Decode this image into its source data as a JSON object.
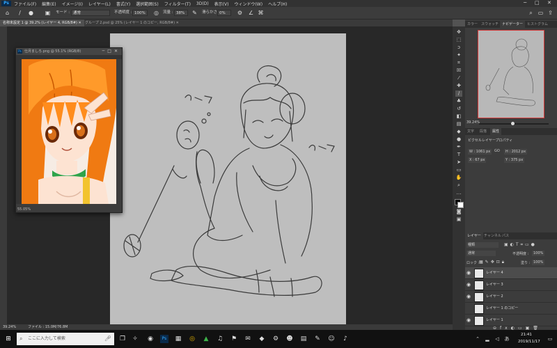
{
  "menubar": {
    "items": [
      "ファイル(F)",
      "編集(E)",
      "イメージ(I)",
      "レイヤー(L)",
      "書式(Y)",
      "選択範囲(S)",
      "フィルター(T)",
      "3D(D)",
      "表示(V)",
      "ウィンドウ(W)",
      "ヘルプ(H)"
    ],
    "window_controls": [
      "─",
      "□",
      "✕"
    ]
  },
  "options": {
    "mode_label": "モード :",
    "mode_value": "通常",
    "opacity_label": "不透明度 :",
    "opacity_value": "100%",
    "flow_label": "流量 :",
    "flow_value": "38%",
    "smoothing_label": "滑らかさ :",
    "smoothing_value": "0%"
  },
  "tabs": [
    {
      "label": "名称未設定 1 @ 39.2% (レイヤー 4, RGB/8#) ✕",
      "active": true
    },
    {
      "label": "グループ 2.psd @ 25% (レイヤー 1 のコピー, RGB/8#) ✕",
      "active": false
    }
  ],
  "floating_window": {
    "title": "仕月ましろ.png @ 55.1% (RGB/8)",
    "controls": [
      "─",
      "□",
      "✕"
    ],
    "zoom": "55.05%"
  },
  "status": {
    "zoom": "39.24%",
    "doc": "ファイル : 15.0M/76.8M"
  },
  "panels": {
    "top_tabs": [
      "カラー",
      "スウォッチ",
      "ナビゲーター",
      "ヒストグラム"
    ],
    "active_top_tab": "ナビゲーター",
    "nav_zoom": "39.24%",
    "mid_tabs": [
      "文字",
      "段落",
      "属性"
    ],
    "active_mid_tab": "属性",
    "props_title": "ピクセルレイヤープロパティ",
    "props": {
      "w": "W : 1061 px",
      "h": "H : 2012 px",
      "x": "X : 67 px",
      "y": "Y : 375 px",
      "link": "GO"
    },
    "layer_tabs": [
      "レイヤー",
      "チャンネル",
      "パス"
    ],
    "active_layer_tab": "レイヤー",
    "kind_label": "種類",
    "blend": "通常",
    "opacity_label": "不透明度 :",
    "opacity": "100%",
    "lock_label": "ロック :",
    "fill_label": "塗り :",
    "fill": "100%",
    "layers": [
      {
        "name": "レイヤー 4",
        "selected": true
      },
      {
        "name": "レイヤー 3",
        "selected": false
      },
      {
        "name": "レイヤー 2",
        "selected": false
      },
      {
        "name": "レイヤー 1 のコピー",
        "selected": false
      },
      {
        "name": "レイヤー 1",
        "selected": false
      }
    ]
  },
  "taskbar": {
    "search_placeholder": "ここに入力して検索",
    "time": "21:41",
    "date": "2019/11/17"
  },
  "colors": {
    "accent": "#31a8ff",
    "nav_frame": "#d63a3a"
  }
}
